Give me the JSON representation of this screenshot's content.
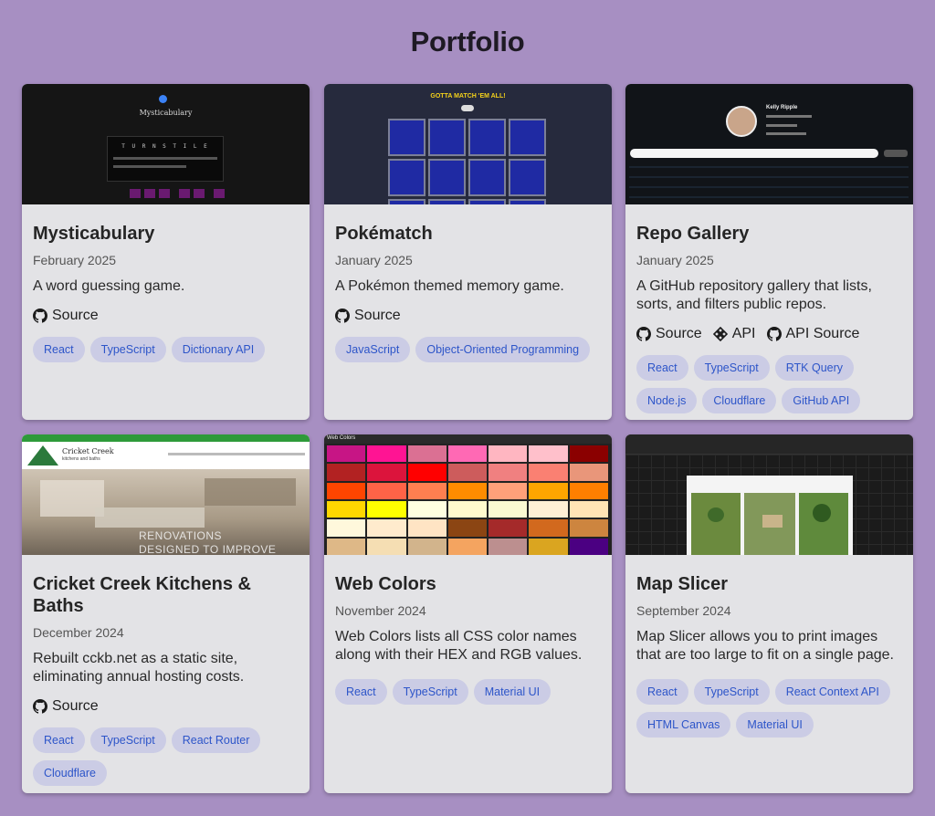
{
  "page": {
    "title": "Portfolio"
  },
  "links": {
    "source": "Source",
    "api": "API",
    "api_source": "API Source"
  },
  "cards": [
    {
      "title": "Mysticabulary",
      "date": "February 2025",
      "desc": "A word guessing game.",
      "tags": [
        "React",
        "TypeScript",
        "Dictionary API"
      ]
    },
    {
      "title": "Pokématch",
      "date": "January 2025",
      "desc": "A Pokémon themed memory game.",
      "tags": [
        "JavaScript",
        "Object-Oriented Programming"
      ]
    },
    {
      "title": "Repo Gallery",
      "date": "January 2025",
      "desc": "A GitHub repository gallery that lists, sorts, and filters public repos.",
      "tags": [
        "React",
        "TypeScript",
        "RTK Query",
        "Node.js",
        "Cloudflare",
        "GitHub API"
      ]
    },
    {
      "title": "Cricket Creek Kitchens & Baths",
      "date": "December 2024",
      "desc": "Rebuilt cckb.net as a static site, eliminating annual hosting costs.",
      "tags": [
        "React",
        "TypeScript",
        "React Router",
        "Cloudflare"
      ]
    },
    {
      "title": "Web Colors",
      "date": "November 2024",
      "desc": "Web Colors lists all CSS color names along with their HEX and RGB values.",
      "tags": [
        "React",
        "TypeScript",
        "Material UI"
      ]
    },
    {
      "title": "Map Slicer",
      "date": "September 2024",
      "desc": "Map Slicer allows you to print images that are too large to fit on a single page.",
      "tags": [
        "React",
        "TypeScript",
        "React Context API",
        "HTML Canvas",
        "Material UI"
      ]
    }
  ],
  "thumbs": {
    "mysticabulary": {
      "heading": "Mysticabulary",
      "word": "T U R N S T I L E"
    },
    "pokematch": {
      "banner": "GOTTA MATCH 'EM ALL!"
    },
    "repo_gallery": {
      "name": "Kelly Ripple"
    },
    "cricket": {
      "brand": "Cricket Creek",
      "tagline": "kitchens and baths",
      "overlay1": "RENOVATIONS",
      "overlay2": "DESIGNED TO IMPROVE"
    },
    "web_colors": {
      "header": "Web Colors"
    }
  }
}
